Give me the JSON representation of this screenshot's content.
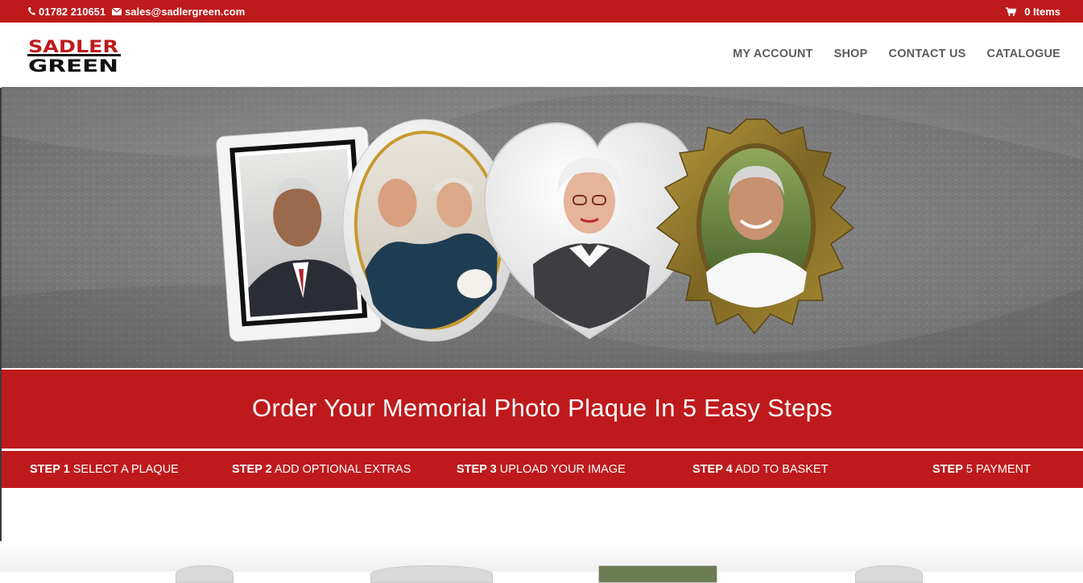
{
  "topbar": {
    "phone": "01782 210651",
    "email": "sales@sadlergreen.com",
    "cart": "0 Items",
    "icons": [
      "phone-icon",
      "envelope-icon",
      "cart-icon"
    ]
  },
  "logo": {
    "line1": "SADLER",
    "line2": "GREEN"
  },
  "nav": {
    "items": [
      {
        "label": "MY ACCOUNT"
      },
      {
        "label": "SHOP"
      },
      {
        "label": "CONTACT US"
      },
      {
        "label": "CATALOGUE"
      }
    ]
  },
  "hero": {
    "alt": ""
  },
  "band": {
    "title": "Order Your Memorial Photo Plaque In 5 Easy Steps"
  },
  "steps": [
    {
      "num": "STEP 1",
      "label": "SELECT A PLAQUE"
    },
    {
      "num": "STEP 2",
      "label": "ADD OPTIONAL EXTRAS"
    },
    {
      "num": "STEP 3",
      "label": "UPLOAD YOUR IMAGE"
    },
    {
      "num": "STEP 4",
      "label": "ADD TO BASKET"
    },
    {
      "num": "STEP",
      "label": "5 PAYMENT"
    }
  ],
  "colors": {
    "brand_red": "#be1a1c",
    "nav_text": "#5c5c5c",
    "logo_black": "#111111"
  }
}
